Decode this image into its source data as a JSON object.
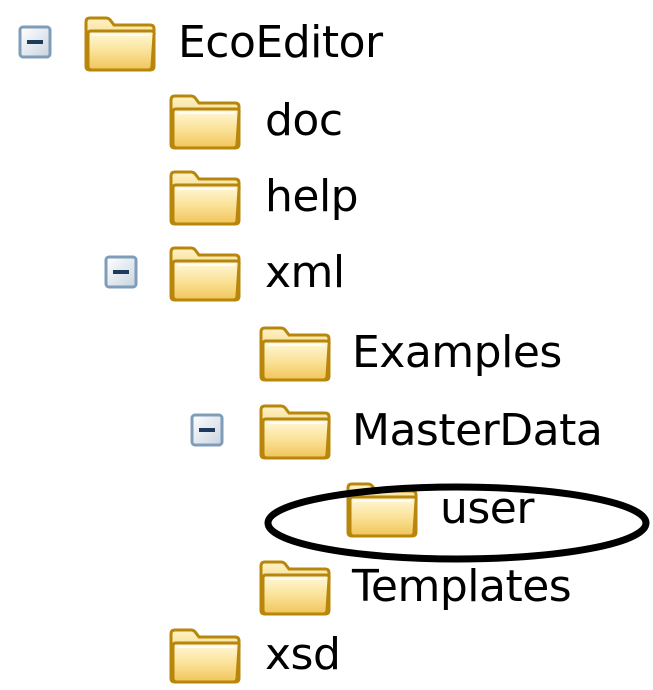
{
  "tree": {
    "root": {
      "label": "EcoEditor",
      "expanded": true,
      "toggle_icon": "minus-box"
    },
    "doc": {
      "label": "doc"
    },
    "help": {
      "label": "help"
    },
    "xml": {
      "label": "xml",
      "expanded": true,
      "toggle_icon": "minus-box"
    },
    "examples": {
      "label": "Examples"
    },
    "masterdata": {
      "label": "MasterData",
      "expanded": true,
      "toggle_icon": "minus-box"
    },
    "user": {
      "label": "user",
      "highlighted": true
    },
    "templates": {
      "label": "Templates"
    },
    "xsd": {
      "label": "xsd"
    }
  },
  "colors": {
    "folder_body": "#F5D97A",
    "folder_front": "#FBE9A6",
    "folder_outline": "#B8860B",
    "toggle_border": "#7F9DB9",
    "highlight_stroke": "#000000"
  }
}
